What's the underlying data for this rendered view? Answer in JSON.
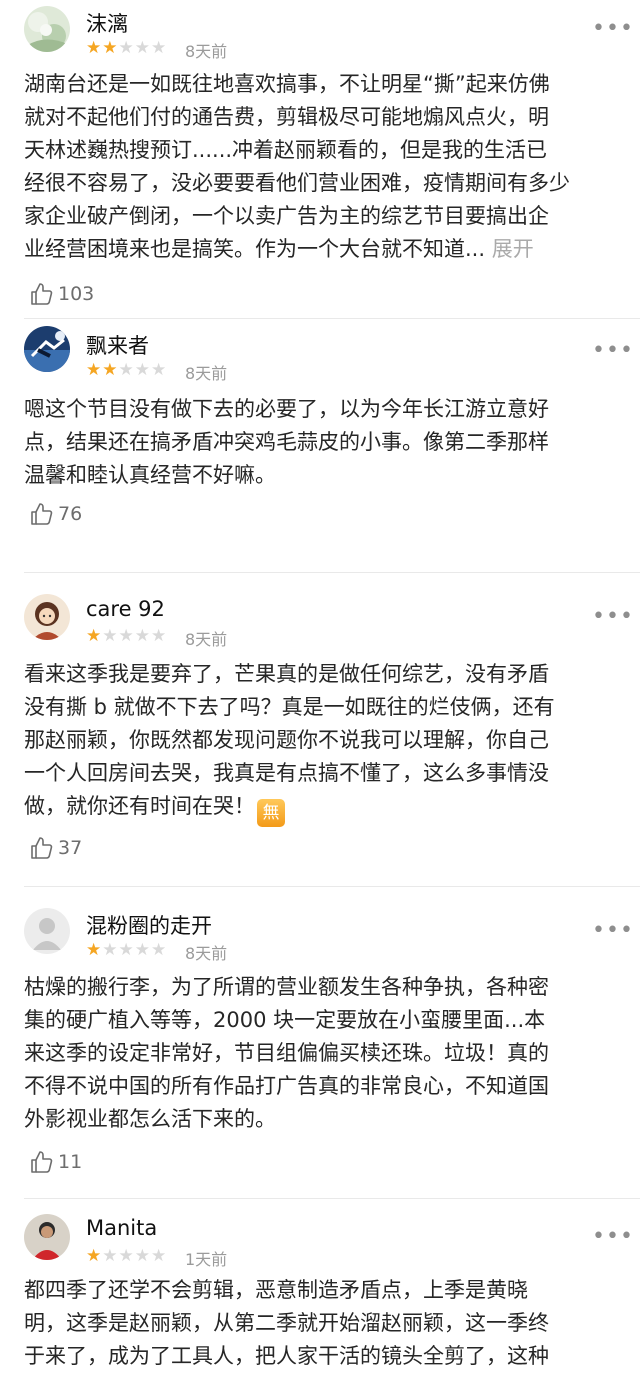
{
  "reviews": [
    {
      "username": "沫漓",
      "rating": 2,
      "time": "8天前",
      "lines": [
        "湖南台还是一如既往地喜欢搞事，不让明星“撕”起来仿佛",
        "就对不起他们付的通告费，剪辑极尽可能地煽风点火，明",
        "天林述巍热搜预订......冲着赵丽颖看的，但是我的生活已",
        "经很不容易了，没必要要看他们营业困难，疫情期间有多少",
        "家企业破产倒闭，一个以卖广告为主的综艺节目要搞出企",
        "业经营困境来也是搞笑。作为一个大台就不知道..."
      ],
      "expand_label": "展开",
      "likes": "103"
    },
    {
      "username": "飘来者",
      "rating": 2,
      "time": "8天前",
      "lines": [
        "嗯这个节目没有做下去的必要了，以为今年长江游立意好",
        "点，结果还在搞矛盾冲突鸡毛蒜皮的小事。像第二季那样",
        "温馨和睦认真经营不好嘛。"
      ],
      "likes": "76"
    },
    {
      "username": "care 92",
      "rating": 1,
      "time": "8天前",
      "lines": [
        "看来这季我是要弃了，芒果真的是做任何综艺，没有矛盾",
        "没有撕 b 就做不下去了吗？真是一如既往的烂伎俩，还有",
        "那赵丽颖，你既然都发现问题你不说我可以理解，你自己",
        "一个人回房间去哭，我真是有点搞不懂了，这么多事情没",
        "做，就你还有时间在哭！"
      ],
      "emoji": "無",
      "likes": "37"
    },
    {
      "username": "混粉圈的走开",
      "rating": 1,
      "time": "8天前",
      "lines": [
        "枯燥的搬行李，为了所谓的营业额发生各种争执，各种密",
        "集的硬广植入等等，2000 块一定要放在小蛮腰里面...本",
        "来这季的设定非常好，节目组偏偏买椟还珠。垃圾！真的",
        "不得不说中国的所有作品打广告真的非常良心，不知道国",
        "外影视业都怎么活下来的。"
      ],
      "likes": "11"
    },
    {
      "username": "Manita",
      "rating": 1,
      "time": "1天前",
      "lines": [
        "都四季了还学不会剪辑，恶意制造矛盾点，上季是黄晓",
        "明，这季是赵丽颖，从第二季就开始溜赵丽颖，这一季终",
        "于来了，成为了工具人，把人家干活的镜头全剪了，这种"
      ]
    }
  ],
  "more_label": "•••",
  "star_glyph": "★",
  "colors": {
    "star_on": "#f5a623",
    "star_off": "#d9d9d9",
    "expand": "#aaaaaa",
    "meta": "#9b9b9b"
  }
}
